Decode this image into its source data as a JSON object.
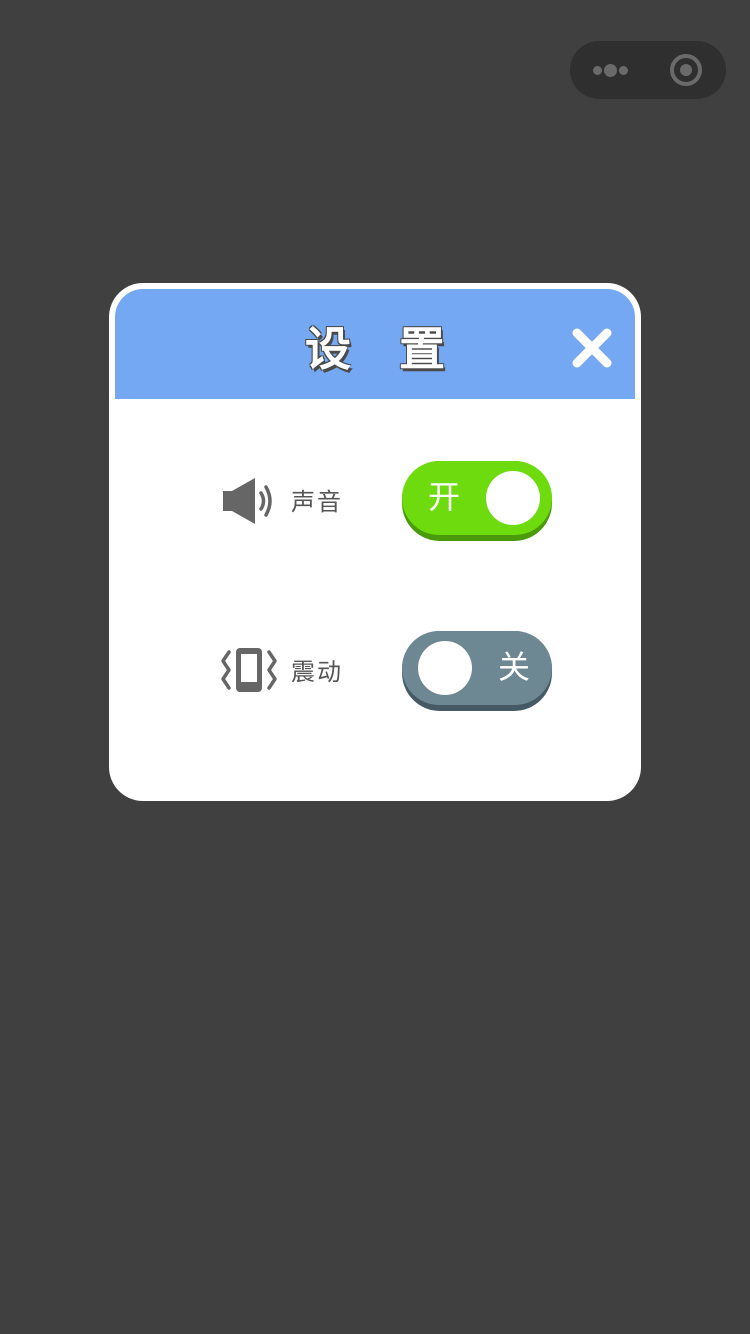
{
  "dialog": {
    "title": "设 置"
  },
  "settings": {
    "sound": {
      "label": "声音",
      "state": "on",
      "toggle_text": "开"
    },
    "vibrate": {
      "label": "震动",
      "state": "off",
      "toggle_text": "关"
    }
  },
  "icons": {
    "sound": "speaker-icon",
    "vibrate": "phone-vibrate-icon",
    "close": "close-icon",
    "capsule_more": "more-dots-icon",
    "capsule_close": "target-circle-icon"
  },
  "colors": {
    "header": "#75a8f2",
    "toggle_on": "#6ddb0d",
    "toggle_off": "#6d8793",
    "backdrop": "#404040"
  }
}
